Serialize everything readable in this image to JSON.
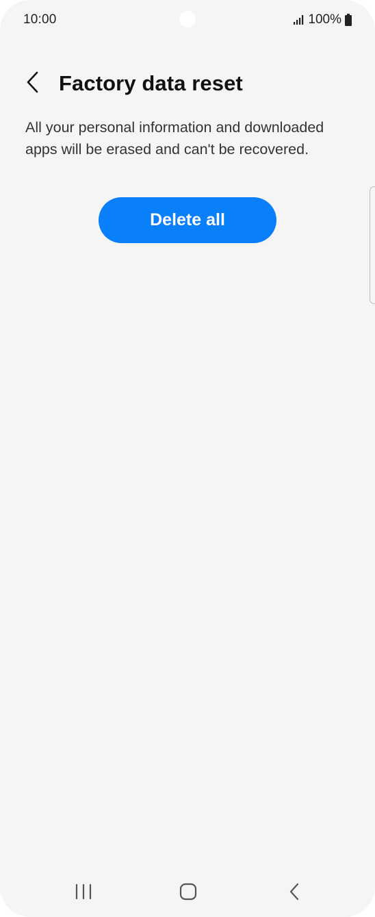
{
  "status_bar": {
    "time": "10:00",
    "battery_percent": "100%",
    "icons": [
      "signal-icon",
      "battery-icon"
    ]
  },
  "header": {
    "back_icon": "chevron-left-icon",
    "title": "Factory data reset"
  },
  "content": {
    "description": "All your personal information and downloaded apps will be erased and can't be recovered.",
    "delete_button_label": "Delete all"
  },
  "nav_bar": {
    "icons": [
      "recents-icon",
      "home-icon",
      "back-icon"
    ]
  },
  "colors": {
    "background": "#f5f5f5",
    "accent": "#0a7ffa",
    "title_text": "#111111",
    "body_text": "#333333"
  }
}
